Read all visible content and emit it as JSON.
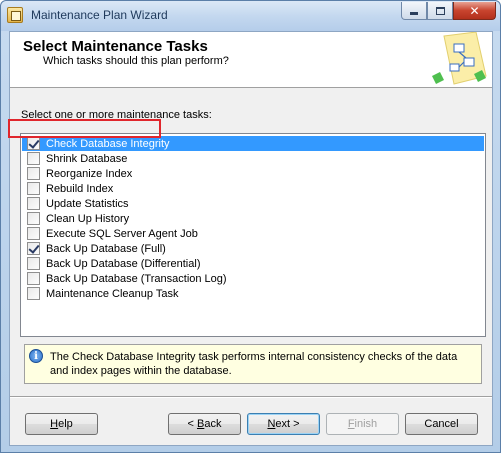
{
  "window": {
    "title": "Maintenance Plan Wizard"
  },
  "header": {
    "title": "Select Maintenance Tasks",
    "subtitle": "Which tasks should this plan perform?"
  },
  "prompt": {
    "mnemonic": "S",
    "rest": "elect one or more maintenance tasks:"
  },
  "tasks": [
    {
      "label": "Check Database Integrity",
      "checked": true,
      "selected": true
    },
    {
      "label": "Shrink Database",
      "checked": false,
      "selected": false
    },
    {
      "label": "Reorganize Index",
      "checked": false,
      "selected": false
    },
    {
      "label": "Rebuild Index",
      "checked": false,
      "selected": false
    },
    {
      "label": "Update Statistics",
      "checked": false,
      "selected": false
    },
    {
      "label": "Clean Up History",
      "checked": false,
      "selected": false
    },
    {
      "label": "Execute SQL Server Agent Job",
      "checked": false,
      "selected": false
    },
    {
      "label": "Back Up Database (Full)",
      "checked": true,
      "selected": false
    },
    {
      "label": "Back Up Database (Differential)",
      "checked": false,
      "selected": false
    },
    {
      "label": "Back Up Database (Transaction Log)",
      "checked": false,
      "selected": false
    },
    {
      "label": "Maintenance Cleanup Task",
      "checked": false,
      "selected": false
    }
  ],
  "info": {
    "text": "The Check Database Integrity task performs internal consistency checks of the data and index pages within the database."
  },
  "buttons": {
    "help": {
      "mnemonic": "H",
      "rest": "elp"
    },
    "back": {
      "prefix": "< ",
      "mnemonic": "B",
      "rest": "ack"
    },
    "next": {
      "mnemonic": "N",
      "rest": "ext >"
    },
    "finish": {
      "mnemonic": "F",
      "rest": "inish"
    },
    "cancel": "Cancel"
  },
  "colors": {
    "selection": "#3399ff",
    "highlight_box": "#e0262c",
    "info_background": "#ffffe1"
  },
  "icons": {
    "app": "maintenance-plan-icon",
    "info": "info-icon",
    "header_art": "wizard-flow-graphic"
  }
}
